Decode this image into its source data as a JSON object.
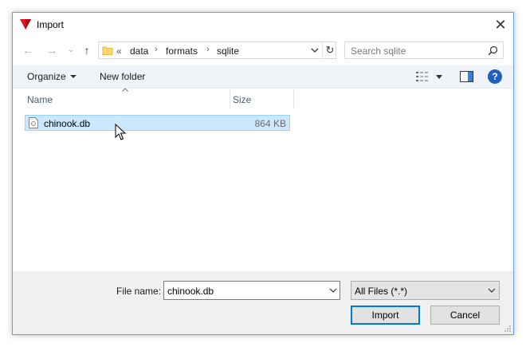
{
  "window": {
    "title": "Import",
    "close_glyph": "✕",
    "accent_color": "#0078d7"
  },
  "nav": {
    "back_glyph": "←",
    "forward_glyph": "→",
    "recent_glyph": "⌄",
    "up_glyph": "↑"
  },
  "address": {
    "overflow": "«",
    "crumbs": [
      "data",
      "formats",
      "sqlite"
    ],
    "separator": "›",
    "refresh_glyph": "↻"
  },
  "search": {
    "placeholder": "Search sqlite"
  },
  "toolbar": {
    "organize_label": "Organize",
    "new_folder_label": "New folder",
    "help_label": "?"
  },
  "file_list": {
    "columns": [
      "Name",
      "Size"
    ],
    "rows": [
      {
        "name": "chinook.db",
        "size": "864 KB",
        "selected": true
      }
    ]
  },
  "bottom": {
    "file_name_label": "File name:",
    "file_name_value": "chinook.db",
    "file_type_value": "All Files (*.*)",
    "import_label": "Import",
    "cancel_label": "Cancel"
  }
}
